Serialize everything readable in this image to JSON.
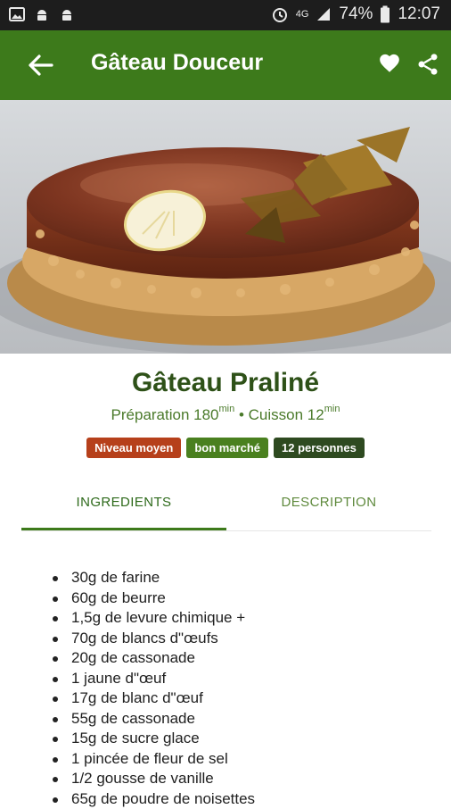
{
  "status_bar": {
    "network": "4G",
    "battery": "74%",
    "time": "12:07",
    "icons": [
      "image-icon",
      "android-icon",
      "android-icon",
      "alarm-icon",
      "signal-icon",
      "battery-icon"
    ]
  },
  "app_bar": {
    "title": "Gâteau Douceur",
    "back_icon": "arrow-back-icon",
    "favorite_icon": "heart-icon",
    "share_icon": "share-icon",
    "color": "#3d7a1b"
  },
  "recipe": {
    "title": "Gâteau Praliné",
    "prep_label": "Préparation 180",
    "prep_unit": "min",
    "separator": " • ",
    "cook_label": "Cuisson 12",
    "cook_unit": "min",
    "badges": {
      "level": "Niveau moyen",
      "price": "bon marché",
      "people": "12 personnes"
    }
  },
  "tabs": {
    "ingredients": "INGREDIENTS",
    "description": "DESCRIPTION",
    "active": "ingredients"
  },
  "ingredients": [
    "30g de farine",
    "60g de beurre",
    "1,5g de levure chimique +",
    "70g de blancs d\"œufs",
    "20g de cassonade",
    "1 jaune d\"œuf",
    "17g de blanc d\"œuf",
    "55g de cassonade",
    "15g de sucre glace",
    "1 pincée de fleur de sel",
    "1/2 gousse de vanille",
    "65g de poudre de noisettes"
  ]
}
